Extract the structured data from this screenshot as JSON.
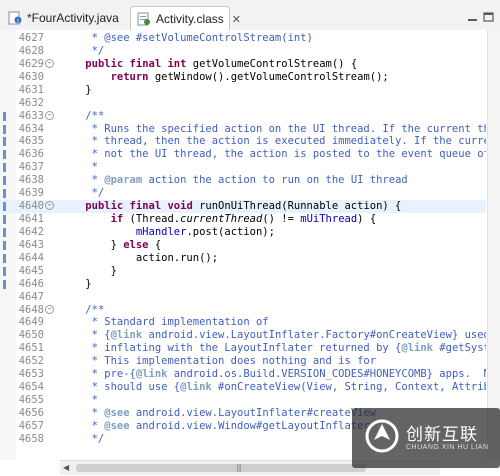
{
  "tabs": [
    {
      "label": "*FourActivity.java",
      "active": false
    },
    {
      "label": "Activity.class",
      "active": true,
      "close_glyph": "✕"
    }
  ],
  "code_lines": [
    {
      "num": "4627",
      "fold": "",
      "mark": false,
      "hl": false,
      "html": "     <span class=\"c\">* @see #setVolumeControlStream(int)</span>"
    },
    {
      "num": "4628",
      "fold": "",
      "mark": false,
      "hl": false,
      "html": "     <span class=\"c\">*/</span>"
    },
    {
      "num": "4629",
      "fold": "-",
      "mark": false,
      "hl": false,
      "html": "    <span class=\"kw\">public final int</span> getVolumeControlStream() {"
    },
    {
      "num": "4630",
      "fold": "",
      "mark": false,
      "hl": false,
      "html": "        <span class=\"kw\">return</span> getWindow().getVolumeControlStream();"
    },
    {
      "num": "4631",
      "fold": "",
      "mark": false,
      "hl": false,
      "html": "    }"
    },
    {
      "num": "4632",
      "fold": "",
      "mark": false,
      "hl": false,
      "html": ""
    },
    {
      "num": "4633",
      "fold": "-",
      "mark": true,
      "hl": false,
      "html": "    <span class=\"c\">/**</span>"
    },
    {
      "num": "4634",
      "fold": "",
      "mark": true,
      "hl": false,
      "html": "     <span class=\"c\">* Runs the specified action on the UI thread. If the current threa</span>"
    },
    {
      "num": "4635",
      "fold": "",
      "mark": true,
      "hl": false,
      "html": "     <span class=\"c\">* thread, then the action is executed immediately. If the current</span>"
    },
    {
      "num": "4636",
      "fold": "",
      "mark": true,
      "hl": false,
      "html": "     <span class=\"c\">* not the UI thread, the action is posted to the event queue of th</span>"
    },
    {
      "num": "4637",
      "fold": "",
      "mark": true,
      "hl": false,
      "html": "     <span class=\"c\">*</span>"
    },
    {
      "num": "4638",
      "fold": "",
      "mark": true,
      "hl": false,
      "html": "     <span class=\"c\">* <span class=\"tagc\">@param</span> action the action to run on the UI thread</span>"
    },
    {
      "num": "4639",
      "fold": "",
      "mark": true,
      "hl": false,
      "html": "     <span class=\"c\">*/</span>"
    },
    {
      "num": "4640",
      "fold": "-",
      "mark": true,
      "hl": true,
      "html": "    <span class=\"kw\">public final void</span> runOnUiThread(Runnable action) {"
    },
    {
      "num": "4641",
      "fold": "",
      "mark": true,
      "hl": false,
      "html": "        <span class=\"kw\">if</span> (Thread.<span class=\"it\">currentThread</span>() != <span class=\"fld\">mUiThread</span>) {"
    },
    {
      "num": "4642",
      "fold": "",
      "mark": true,
      "hl": false,
      "html": "            <span class=\"fld\">mHandler</span>.post(action);"
    },
    {
      "num": "4643",
      "fold": "",
      "mark": true,
      "hl": false,
      "html": "        } <span class=\"kw\">else</span> {"
    },
    {
      "num": "4644",
      "fold": "",
      "mark": true,
      "hl": false,
      "html": "            action.run();"
    },
    {
      "num": "4645",
      "fold": "",
      "mark": true,
      "hl": false,
      "html": "        }"
    },
    {
      "num": "4646",
      "fold": "",
      "mark": true,
      "hl": false,
      "html": "    }"
    },
    {
      "num": "4647",
      "fold": "",
      "mark": false,
      "hl": false,
      "html": ""
    },
    {
      "num": "4648",
      "fold": "-",
      "mark": false,
      "hl": false,
      "html": "    <span class=\"c\">/**</span>"
    },
    {
      "num": "4649",
      "fold": "",
      "mark": false,
      "hl": false,
      "html": "     <span class=\"c\">* Standard implementation of</span>"
    },
    {
      "num": "4650",
      "fold": "",
      "mark": false,
      "hl": false,
      "html": "     <span class=\"c\">* {<span class=\"tagc\">@link</span> android.view.LayoutInflater.Factory#onCreateView} used wh</span>"
    },
    {
      "num": "4651",
      "fold": "",
      "mark": false,
      "hl": false,
      "html": "     <span class=\"c\">* inflating with the LayoutInflater returned by {<span class=\"tagc\">@link</span> #getSystemS</span>"
    },
    {
      "num": "4652",
      "fold": "",
      "mark": false,
      "hl": false,
      "html": "     <span class=\"c\">* This implementation does nothing and is for</span>"
    },
    {
      "num": "4653",
      "fold": "",
      "mark": false,
      "hl": false,
      "html": "     <span class=\"c\">* pre-{<span class=\"tagc\">@link</span> android.os.Build.VERSION_CODES#HONEYCOMB} apps.  Newe</span>"
    },
    {
      "num": "4654",
      "fold": "",
      "mark": false,
      "hl": false,
      "html": "     <span class=\"c\">* should use {<span class=\"tagc\">@link</span> #onCreateView(View, String, Context, Attribute</span>"
    },
    {
      "num": "4655",
      "fold": "",
      "mark": false,
      "hl": false,
      "html": "     <span class=\"c\">*</span>"
    },
    {
      "num": "4656",
      "fold": "",
      "mark": false,
      "hl": false,
      "html": "     <span class=\"c\">* <span class=\"tagc\">@see</span> android.view.LayoutInflater#createView</span>"
    },
    {
      "num": "4657",
      "fold": "",
      "mark": false,
      "hl": false,
      "html": "     <span class=\"c\">* <span class=\"tagc\">@see</span> android.view.Window#getLayoutInflater</span>"
    },
    {
      "num": "4658",
      "fold": "",
      "mark": false,
      "hl": false,
      "html": "     <span class=\"c\">*/</span>"
    }
  ],
  "watermark": {
    "brand_cn": "创新互联",
    "brand_en": "CHUANG XIN HU LIAN"
  },
  "colors": {
    "keyword": "#7f0055",
    "comment": "#3f5fbf",
    "field": "#0000c0",
    "current_line": "#e8f2fe",
    "marker": "#6a93c7"
  }
}
